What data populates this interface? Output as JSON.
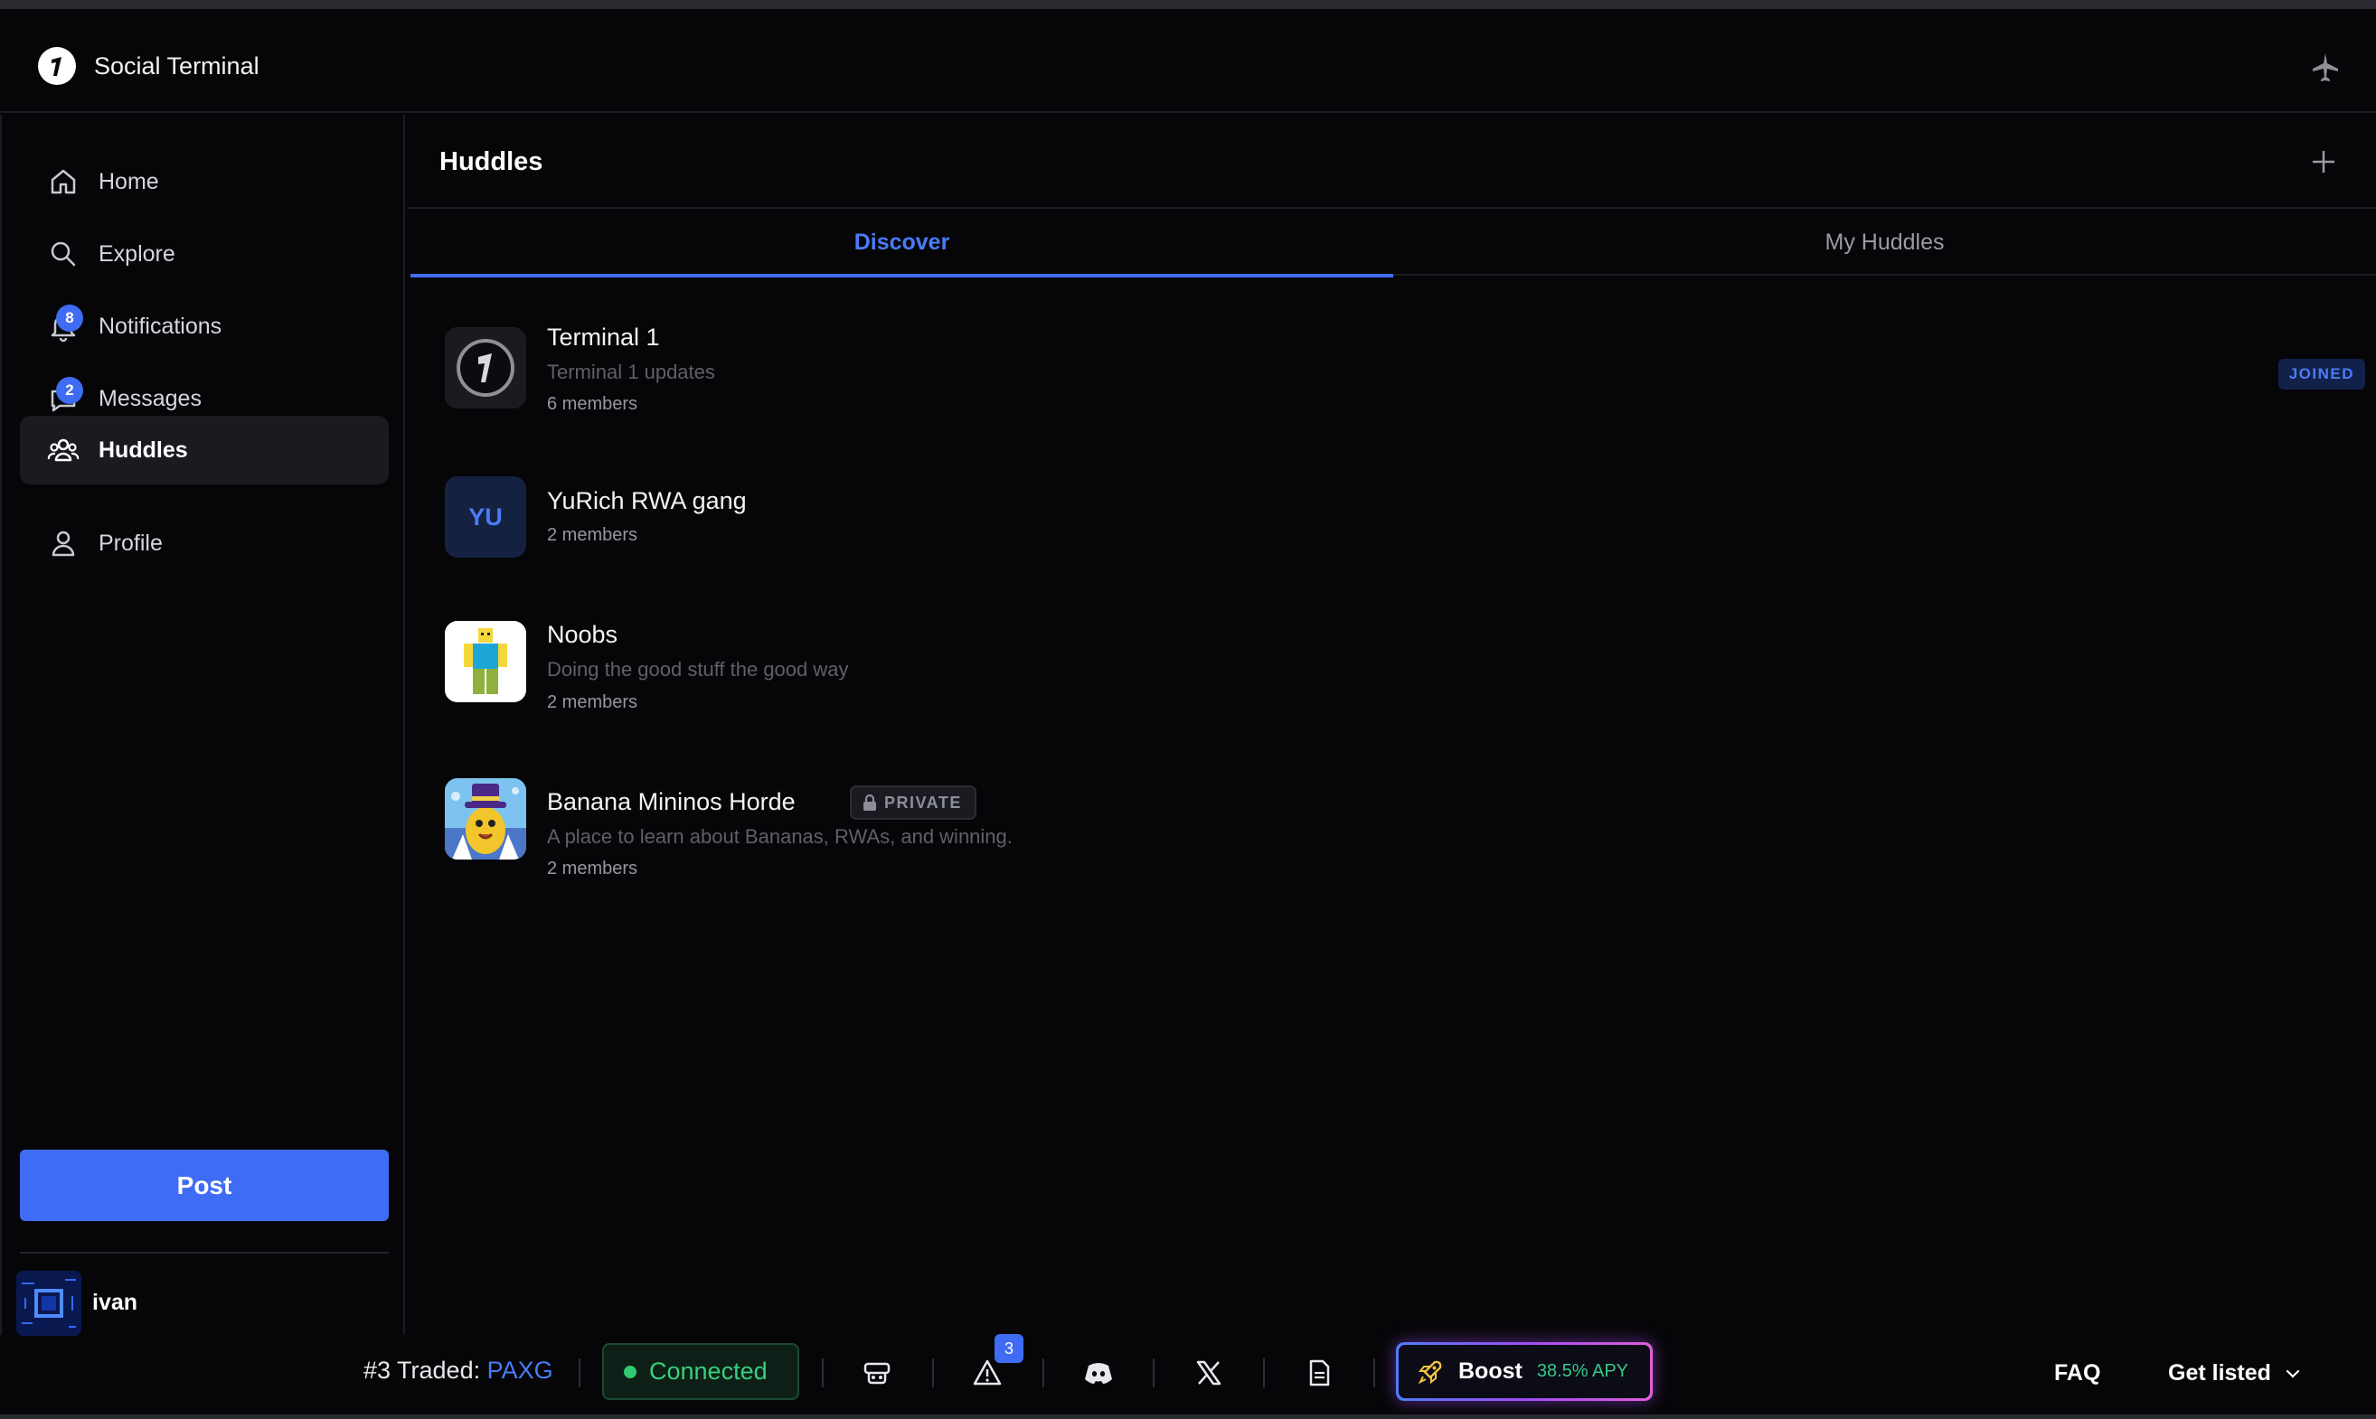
{
  "app": {
    "title": "Social Terminal"
  },
  "sidebar": {
    "items": [
      {
        "label": "Home",
        "icon": "home-icon"
      },
      {
        "label": "Explore",
        "icon": "search-icon"
      },
      {
        "label": "Notifications",
        "icon": "bell-icon",
        "badge": "8"
      },
      {
        "label": "Messages",
        "icon": "message-icon",
        "badge": "2"
      },
      {
        "label": "Huddles",
        "icon": "users-icon",
        "active": true
      },
      {
        "label": "Profile",
        "icon": "user-icon"
      }
    ],
    "post_label": "Post",
    "user": {
      "name": "ivan"
    }
  },
  "main": {
    "title": "Huddles",
    "tabs": [
      {
        "label": "Discover",
        "active": true
      },
      {
        "label": "My Huddles",
        "active": false
      }
    ],
    "huddles": [
      {
        "name": "Terminal 1",
        "description": "Terminal 1 updates",
        "members": "6 members",
        "badge": "JOINED"
      },
      {
        "name": "YuRich RWA gang",
        "initials": "YU",
        "members": "2 members"
      },
      {
        "name": "Noobs",
        "description": "Doing the good stuff the good way",
        "members": "2 members"
      },
      {
        "name": "Banana Mininos Horde",
        "badge": "PRIVATE",
        "description": "A place to learn about Bananas, RWAs, and winning.",
        "members": "2 members"
      }
    ]
  },
  "bottombar": {
    "traded_prefix": "#3 Traded:",
    "traded_symbol": "PAXG",
    "connection_status": "Connected",
    "alerts_count": "3",
    "boost_label": "Boost",
    "boost_apy": "38.5% APY",
    "faq_label": "FAQ",
    "get_listed_label": "Get listed",
    "icons": [
      "bot-icon",
      "alert-triangle-icon",
      "discord-icon",
      "x-logo-icon",
      "document-icon",
      "rocket-icon"
    ]
  },
  "colors": {
    "accent": "#3f6cf2",
    "connected": "#37d07d",
    "background": "#060608"
  }
}
